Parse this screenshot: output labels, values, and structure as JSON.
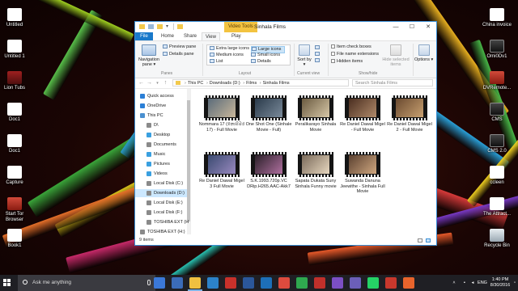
{
  "desktop": {
    "left_icons": [
      {
        "label": "Untitled",
        "glyph": "g-doc"
      },
      {
        "label": "Untitled 1",
        "glyph": "g-doc"
      },
      {
        "label": "Lion Tubs",
        "glyph": "g-lion"
      },
      {
        "label": "Doc1",
        "glyph": "g-doc"
      },
      {
        "label": "Doc1",
        "glyph": "g-doc"
      },
      {
        "label": "Capture",
        "glyph": "g-doc"
      },
      {
        "label": "Start Tor Browser",
        "glyph": "g-red"
      },
      {
        "label": "Book1",
        "glyph": "g-doc"
      }
    ],
    "right_icons": [
      {
        "label": "China invoice",
        "glyph": "g-doc"
      },
      {
        "label": "Omi0Dv1",
        "glyph": "g-dark"
      },
      {
        "label": "DVRemote...",
        "glyph": "g-red"
      },
      {
        "label": "CMS",
        "glyph": "g-dark"
      },
      {
        "label": "CMS 2.0",
        "glyph": "g-dark"
      },
      {
        "label": "ccleen",
        "glyph": "g-doc"
      },
      {
        "label": "The Attract...",
        "glyph": "g-doc"
      },
      {
        "label": "Recycle Bin",
        "glyph": "g-bin"
      }
    ]
  },
  "window": {
    "contextual_tab": "Video Tools",
    "title": "Sinhala Films",
    "controls": {
      "minimize": "—",
      "maximize": "☐",
      "close": "✕"
    },
    "tabs": [
      "File",
      "Home",
      "Share",
      "View",
      "Play"
    ],
    "active_tab": "View",
    "ribbon": {
      "panes_group": "Panes",
      "navigation_pane": "Navigation pane ▾",
      "preview_pane": "Preview pane",
      "details_pane": "Details pane",
      "layout_group": "Layout",
      "layout_items": [
        "Extra large icons",
        "Large icons",
        "Medium icons",
        "Small icons",
        "List",
        "Details"
      ],
      "layout_selected": "Large icons",
      "current_view_group": "Current view",
      "sort_by": "Sort by ▾",
      "showhide_group": "Show/hide",
      "item_check_boxes": "Item check boxes",
      "file_name_extensions": "File name extensions",
      "hidden_items": "Hidden items",
      "hide_selected": "Hide selected items",
      "options": "Options ▾"
    },
    "address": {
      "crumbs": [
        "This PC",
        "Downloads (D:)",
        "Films",
        "Sinhala Films"
      ],
      "search_placeholder": "Search Sinhala Films"
    },
    "nav": [
      {
        "label": "Quick access",
        "color": "#2b7fd6",
        "indent": 0
      },
      {
        "label": "OneDrive",
        "color": "#2b7fd6",
        "indent": 0
      },
      {
        "label": "This PC",
        "color": "#4a90d0",
        "indent": 0
      },
      {
        "label": "D\\",
        "color": "#8a8a8a",
        "indent": 1
      },
      {
        "label": "Desktop",
        "color": "#3aa0e0",
        "indent": 1
      },
      {
        "label": "Documents",
        "color": "#8a8a8a",
        "indent": 1
      },
      {
        "label": "Music",
        "color": "#3aa0e0",
        "indent": 1
      },
      {
        "label": "Pictures",
        "color": "#3aa0e0",
        "indent": 1
      },
      {
        "label": "Videos",
        "color": "#3aa0e0",
        "indent": 1
      },
      {
        "label": "Local Disk (C:)",
        "color": "#8a8a8a",
        "indent": 1
      },
      {
        "label": "Downloads (D:)",
        "color": "#8a8a8a",
        "indent": 1,
        "selected": true
      },
      {
        "label": "Local Disk (E:)",
        "color": "#8a8a8a",
        "indent": 1
      },
      {
        "label": "Local Disk (F:)",
        "color": "#8a8a8a",
        "indent": 1
      },
      {
        "label": "TOSHIBA EXT (H",
        "color": "#8a8a8a",
        "indent": 1
      },
      {
        "label": "TOSHIBA EXT (H:)",
        "color": "#8a8a8a",
        "indent": 0
      }
    ],
    "files": [
      {
        "name": "Nommara 17 (නොම්මර 17) - Full Movie",
        "tone": [
          "#5a6b7a",
          "#c9b79a"
        ]
      },
      {
        "name": "One Shot One (Sinhale Movie - Full)",
        "tone": [
          "#2a3a4a",
          "#7a8a9a"
        ]
      },
      {
        "name": "Peralikarayo Sinhala Movie",
        "tone": [
          "#6a5a40",
          "#d8c8a8"
        ]
      },
      {
        "name": "Re Daniel Dawal Migel - Full Movie",
        "tone": [
          "#4a2e20",
          "#b08a6a"
        ]
      },
      {
        "name": "Re Daniel Dawal Migel 2 - Full Movie",
        "tone": [
          "#6a4a30",
          "#c8a070"
        ]
      },
      {
        "name": "Re Daniel Dawal Migel 3 Full Movie",
        "tone": [
          "#3a4a70",
          "#9a8ac0"
        ]
      },
      {
        "name": "S.K.1993.720p.VC DRip.H265.AAC-Akk7",
        "tone": [
          "#2a2028",
          "#b070a0"
        ]
      },
      {
        "name": "Sapata Dukata Suny Sinhala Funny movie",
        "tone": [
          "#7a6a5a",
          "#e8d8c0"
        ]
      },
      {
        "name": "Suwanda Danuna Jeewithe - Sinhala Full Movie",
        "tone": [
          "#5a4030",
          "#d0a880"
        ]
      }
    ],
    "status": "9 items"
  },
  "taskbar": {
    "search_placeholder": "Ask me anything",
    "apps": [
      "#3b78d8",
      "#3b6bb8",
      "#f0c040",
      "#2c82c9",
      "#c8312b",
      "#2b579a",
      "#1d6fb8",
      "#dd4b3e",
      "#2fa84f",
      "#c0302b",
      "#7b4fc4",
      "#6b5fb8",
      "#25d366",
      "#c8382d",
      "#e8642c"
    ],
    "language": "ENG",
    "time": "1:40 PM",
    "date": "8/30/2016"
  }
}
